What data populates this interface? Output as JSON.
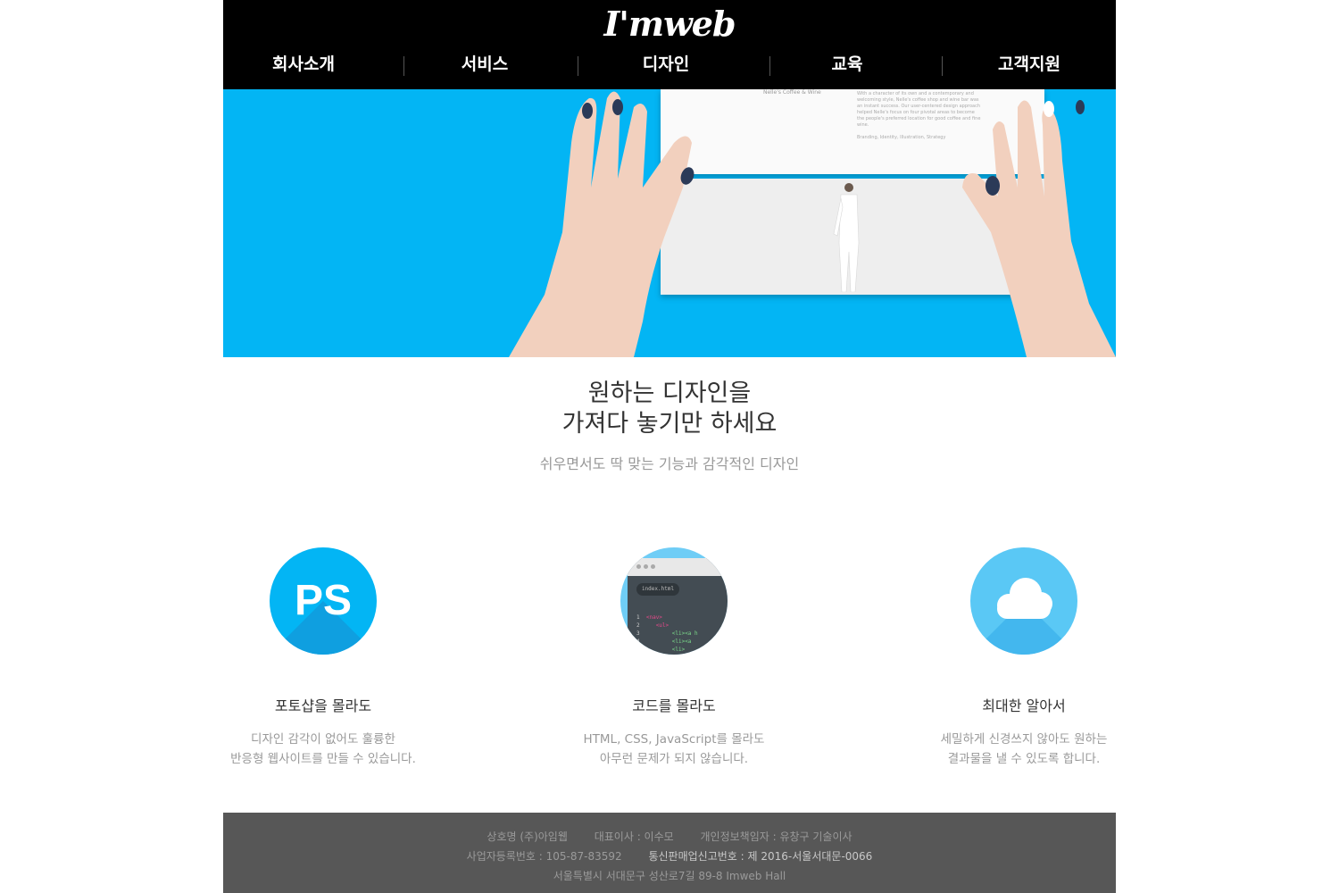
{
  "header": {
    "logo": "I'mweb",
    "nav": [
      {
        "label": "회사소개"
      },
      {
        "label": "서비스"
      },
      {
        "label": "디자인"
      },
      {
        "label": "교육"
      },
      {
        "label": "고객지원"
      }
    ]
  },
  "hero": {
    "paper_caption": "Nelle's Coffee & Wine",
    "paper_text": "With a character of its own and a contemporary and welcoming style, Nelle's coffee shop and wine bar was an instant success. Our user-centered design approach helped Nelle's focus on four pivotal areas to become the people's preferred location for good coffee and fine wine.",
    "paper_tags": "Branding, Identity, Illustration, Strategy"
  },
  "headline": {
    "line1": "원하는 디자인을",
    "line2": "가져다 놓기만 하세요",
    "sub": "쉬우면서도 딱 맞는 기능과 감각적인 디자인"
  },
  "features": [
    {
      "icon": "photoshop-icon",
      "icon_text": "PS",
      "title": "포토샵을 몰라도",
      "desc1": "디자인 감각이 없어도 훌륭한",
      "desc2": "반응형 웹사이트를 만들 수 있습니다."
    },
    {
      "icon": "code-editor-icon",
      "title": "코드를 몰라도",
      "desc1": "HTML, CSS, JavaScript를 몰라도",
      "desc2": "아무런 문제가 되지 않습니다."
    },
    {
      "icon": "cloud-icon",
      "title": "최대한 알아서",
      "desc1": "세밀하게 신경쓰지 않아도 원하는",
      "desc2": "결과물을 낼 수 있도록 합니다."
    }
  ],
  "code_sample": {
    "tab": "index.html",
    "lines": [
      {
        "num": "1",
        "text": "<nav>"
      },
      {
        "num": "2",
        "text": "<ul>"
      },
      {
        "num": "3",
        "text": "<li><a h"
      },
      {
        "num": "4",
        "text": "<li><a"
      },
      {
        "num": "5",
        "text": "<li>"
      }
    ]
  },
  "footer": {
    "company": "상호명 (주)아임웹",
    "ceo": "대표이사 : 이수모",
    "privacy": "개인정보책임자 : 유창구 기술이사",
    "biz_no": "사업자등록번호 : 105-87-83592",
    "ecommerce_label": "통신판매업신고번호 : ",
    "ecommerce_no": "제 2016-서울서대문-0066",
    "address": "서울특별시 서대문구 성산로7길 89-8 Imweb Hall"
  },
  "colors": {
    "header_bg": "#000000",
    "hero_bg": "#03b5f4",
    "footer_bg": "#575757",
    "accent": "#03b5f4"
  }
}
